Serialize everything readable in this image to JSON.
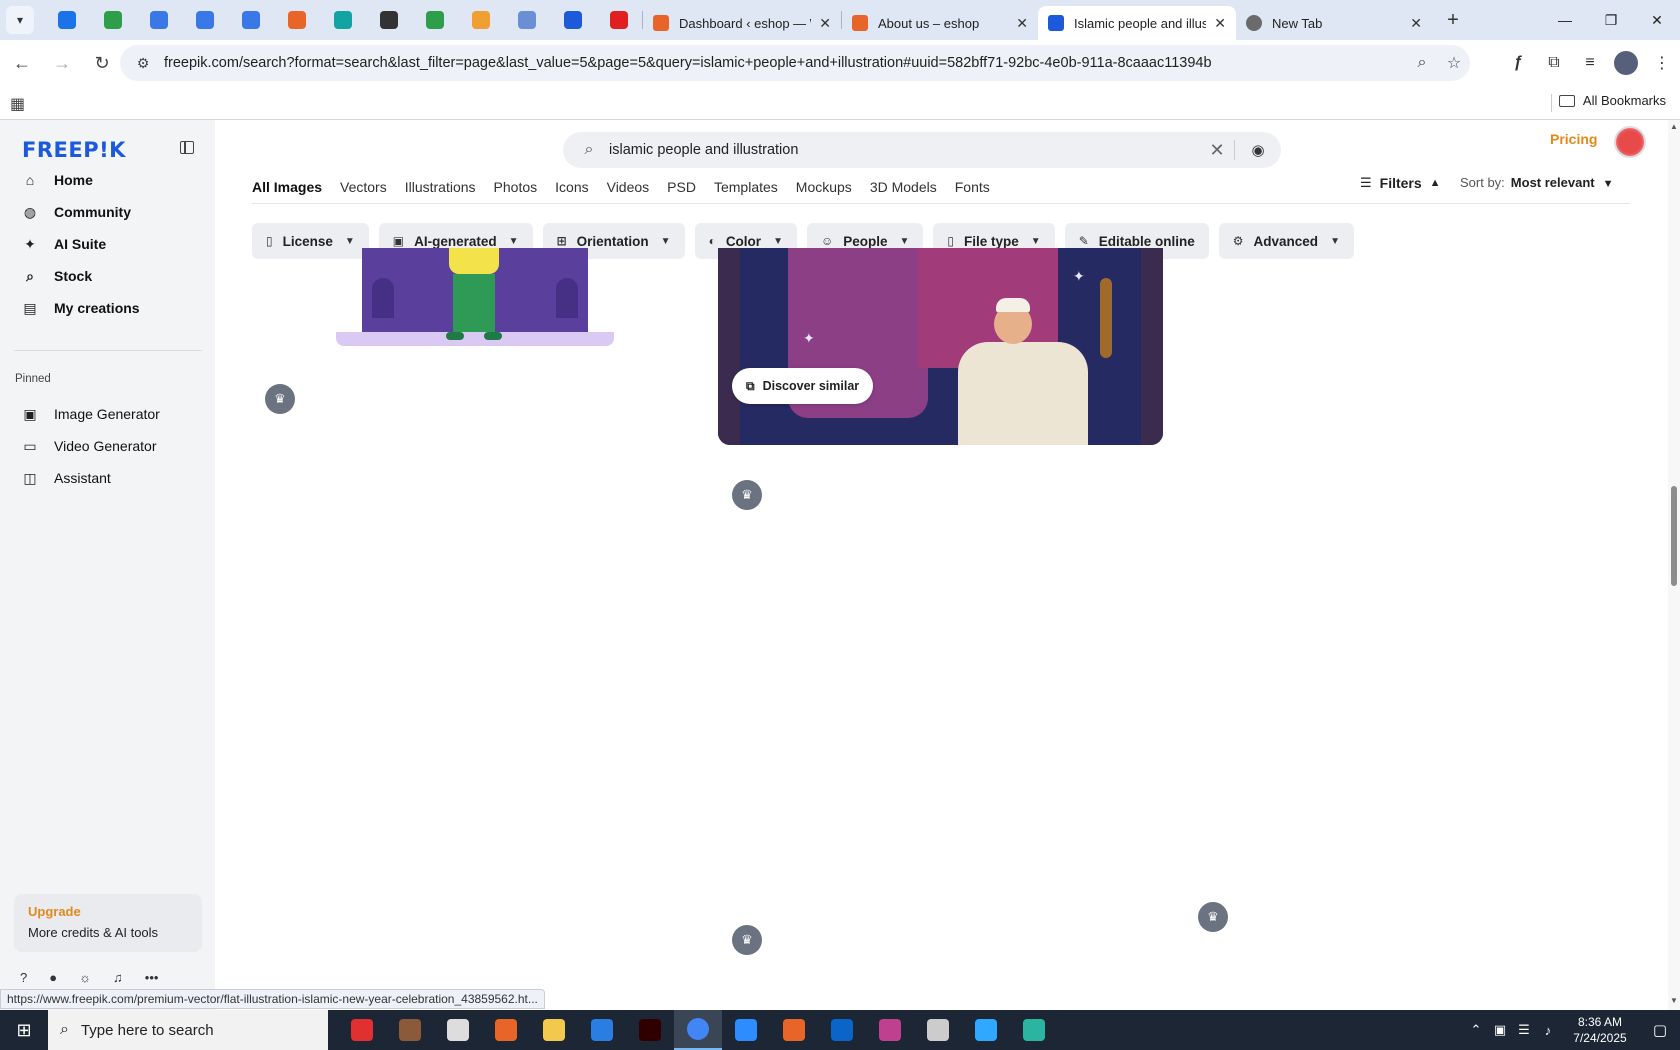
{
  "browser": {
    "tabs": [
      {
        "title": "Dashboard ‹ eshop — Wo",
        "favicon_color": "#e8652a",
        "active": false
      },
      {
        "title": "About us – eshop",
        "favicon_color": "#e8652a",
        "active": false
      },
      {
        "title": "Islamic people and illustra",
        "favicon_color": "#1d5ad9",
        "active": true
      },
      {
        "title": "New Tab",
        "favicon_color": "#6b6b6b",
        "active": false
      }
    ],
    "pinned_tab_colors": [
      "#1a73e8",
      "#2e9e4a",
      "#3b78e7",
      "#3b78e7",
      "#3b78e7",
      "#e8652a",
      "#12a3a3",
      "#333333",
      "#2e9e4a",
      "#f0a030",
      "#6b8fd6",
      "#1d5ad9",
      "#e02020"
    ],
    "url": "freepik.com/search?format=search&last_filter=page&last_value=5&page=5&query=islamic+people+and+illustration#uuid=582bff71-92bc-4e0b-911a-8caaac11394b",
    "all_bookmarks": "All Bookmarks",
    "status_url": "https://www.freepik.com/premium-vector/flat-illustration-islamic-new-year-celebration_43859562.ht..."
  },
  "sidebar": {
    "logo": "FREEP!K",
    "nav": [
      {
        "label": "Home",
        "icon": "home-icon"
      },
      {
        "label": "Community",
        "icon": "globe-icon"
      },
      {
        "label": "AI Suite",
        "icon": "sparkle-icon"
      },
      {
        "label": "Stock",
        "icon": "search-icon"
      },
      {
        "label": "My creations",
        "icon": "library-icon"
      }
    ],
    "pinned_label": "Pinned",
    "pinned": [
      {
        "label": "Image Generator",
        "icon": "image-icon"
      },
      {
        "label": "Video Generator",
        "icon": "video-icon"
      },
      {
        "label": "Assistant",
        "icon": "chat-icon"
      }
    ],
    "upgrade": {
      "title": "Upgrade",
      "subtitle": "More credits & AI tools"
    }
  },
  "header": {
    "search_query": "islamic people and illustration",
    "pricing": "Pricing"
  },
  "type_tabs": [
    "All Images",
    "Vectors",
    "Illustrations",
    "Photos",
    "Icons",
    "Videos",
    "PSD",
    "Templates",
    "Mockups",
    "3D Models",
    "Fonts"
  ],
  "filters_label": "Filters",
  "sort": {
    "label": "Sort by:",
    "value": "Most relevant"
  },
  "filter_chips": [
    {
      "label": "License",
      "icon": "license-icon"
    },
    {
      "label": "AI-generated",
      "icon": "ai-icon"
    },
    {
      "label": "Orientation",
      "icon": "orientation-icon"
    },
    {
      "label": "Color",
      "icon": "palette-icon"
    },
    {
      "label": "People",
      "icon": "people-icon"
    },
    {
      "label": "File type",
      "icon": "file-icon"
    },
    {
      "label": "Editable online",
      "icon": "pencil-icon"
    },
    {
      "label": "Advanced",
      "icon": "gear-icon"
    }
  ],
  "results": {
    "discover_similar": "Discover similar"
  },
  "taskbar": {
    "search_placeholder": "Type here to search",
    "time": "8:36 AM",
    "date": "7/24/2025",
    "app_colors": [
      "#e03030",
      "#8a5a3a",
      "#dddddd",
      "#e8652a",
      "#f2c94c",
      "#2a7de1",
      "#300000",
      "#4285f4",
      "#2d8cff",
      "#e8652a",
      "#0b64c8",
      "#c04090",
      "#cccccc",
      "#31a8ff",
      "#2bb5a0"
    ]
  },
  "colors": {
    "brand": "#1d5ad9",
    "pricing": "#e3881a",
    "active_tab_bg": "#ffffff"
  }
}
